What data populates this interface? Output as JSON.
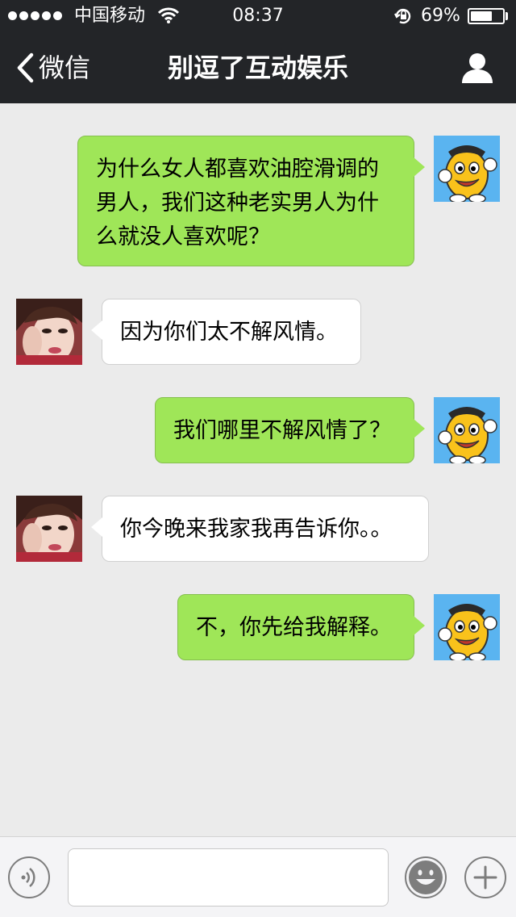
{
  "status_bar": {
    "carrier": "中国移动",
    "time": "08:37",
    "battery_percent_text": "69%",
    "battery_level": 0.69
  },
  "nav": {
    "back_label": "微信",
    "title": "别逗了互动娱乐",
    "profile_icon": "person-icon"
  },
  "messages": [
    {
      "side": "out",
      "text": "为什么女人都喜欢油腔滑调的男人，我们这种老实男人为什么就没人喜欢呢？",
      "avatar": "cartoon-mascot"
    },
    {
      "side": "in",
      "text": "因为你们太不解风情。",
      "avatar": "girl-photo"
    },
    {
      "side": "out",
      "text": "我们哪里不解风情了？",
      "avatar": "cartoon-mascot"
    },
    {
      "side": "in",
      "text": "你今晚来我家我再告诉你。。",
      "avatar": "girl-photo"
    },
    {
      "side": "out",
      "text": "不，你先给我解释。",
      "avatar": "cartoon-mascot"
    }
  ],
  "input_bar": {
    "voice_icon": "voice-icon",
    "text_value": "",
    "emoji_icon": "emoji-icon",
    "plus_icon": "plus-icon"
  },
  "colors": {
    "nav_bg": "#232528",
    "chat_bg": "#ebebeb",
    "outgoing_bubble": "#9fe658",
    "incoming_bubble": "#ffffff",
    "input_bar_bg": "#f4f4f6"
  }
}
